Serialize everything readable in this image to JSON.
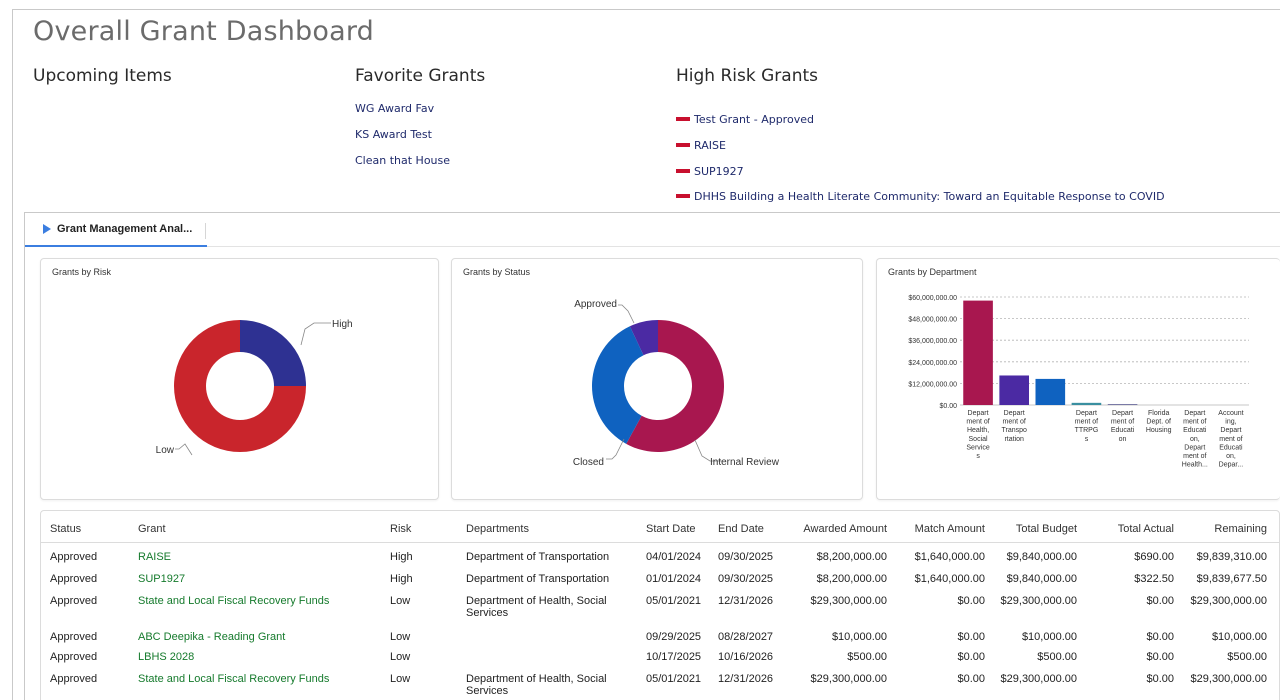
{
  "page": {
    "title": "Overall Grant Dashboard"
  },
  "upcoming": {
    "heading": "Upcoming Items"
  },
  "favorites": {
    "heading": "Favorite Grants",
    "items": [
      "WG Award Fav",
      "KS Award Test",
      "Clean that House"
    ]
  },
  "high_risk": {
    "heading": "High Risk Grants",
    "items": [
      "Test Grant - Approved",
      "RAISE",
      "SUP1927",
      "DHHS Building a Health Literate Community: Toward an Equitable Response to COVID"
    ]
  },
  "analytics": {
    "tab_label": "Grant Management Anal...",
    "tab_icon": "play-triangle-icon",
    "accent_color": "#3b7ee0"
  },
  "chart_data": [
    {
      "type": "pie",
      "donut": true,
      "title": "Grants by Risk",
      "slices": [
        {
          "label": "High",
          "value": 25,
          "color": "#2e3192"
        },
        {
          "label": "Low",
          "value": 75,
          "color": "#c9252c"
        }
      ]
    },
    {
      "type": "pie",
      "donut": true,
      "title": "Grants by Status",
      "slices": [
        {
          "label": "Approved",
          "value": 58,
          "color": "#a8174f"
        },
        {
          "label": "Internal Review",
          "value": 35,
          "color": "#0f62c0"
        },
        {
          "label": "Closed",
          "value": 7,
          "color": "#4b2aa3"
        }
      ]
    },
    {
      "type": "bar",
      "title": "Grants by Department",
      "categories": [
        "Department of Health, Social Services",
        "Department of Transportation",
        "",
        "Department of TTRPGs",
        "Department of Education",
        "Florida Dept. of Housing",
        "Department of Education, Department of Health...",
        "Accounting, Department of Education, Depar..."
      ],
      "category_labels": [
        [
          "Depart",
          "ment of",
          "Health,",
          "Social",
          "Service",
          "s"
        ],
        [
          "Depart",
          "ment of",
          "Transpo",
          "rtation"
        ],
        [],
        [
          "Depart",
          "ment of",
          "TTRPG",
          "s"
        ],
        [
          "Depart",
          "ment of",
          "Educati",
          "on"
        ],
        [
          "Florida",
          "Dept. of",
          "Housing"
        ],
        [
          "Depart",
          "ment of",
          "Educati",
          "on,",
          "Depart",
          "ment of",
          "Health..."
        ],
        [
          "Account",
          "ing,",
          "Depart",
          "ment of",
          "Educati",
          "on,",
          "Depar..."
        ]
      ],
      "values": [
        58000000,
        16400000,
        14500000,
        1200000,
        500000,
        0,
        0,
        0
      ],
      "colors": [
        "#a8174f",
        "#4b2aa3",
        "#0f62c0",
        "#3a8fa0",
        "#6c6c9c",
        "#888888",
        "#888888",
        "#888888"
      ],
      "ylim": [
        0,
        60000000
      ],
      "yticks": [
        "$0.00",
        "$12,000,000.00",
        "$24,000,000.00",
        "$36,000,000.00",
        "$48,000,000.00",
        "$60,000,000.00"
      ],
      "grid": true
    }
  ],
  "table": {
    "columns": [
      "Status",
      "Grant",
      "Risk",
      "Departments",
      "Start Date",
      "End Date",
      "Awarded Amount",
      "Match Amount",
      "Total Budget",
      "Total Actual",
      "Remaining"
    ],
    "rows": [
      [
        "Approved",
        "RAISE",
        "High",
        "Department of Transportation",
        "04/01/2024",
        "09/30/2025",
        "$8,200,000.00",
        "$1,640,000.00",
        "$9,840,000.00",
        "$690.00",
        "$9,839,310.00"
      ],
      [
        "Approved",
        "SUP1927",
        "High",
        "Department of Transportation",
        "01/01/2024",
        "09/30/2025",
        "$8,200,000.00",
        "$1,640,000.00",
        "$9,840,000.00",
        "$322.50",
        "$9,839,677.50"
      ],
      [
        "Approved",
        "State and Local Fiscal Recovery Funds",
        "Low",
        "Department of Health, Social Services",
        "05/01/2021",
        "12/31/2026",
        "$29,300,000.00",
        "$0.00",
        "$29,300,000.00",
        "$0.00",
        "$29,300,000.00"
      ],
      [
        "Approved",
        "ABC Deepika - Reading Grant",
        "Low",
        "",
        "09/29/2025",
        "08/28/2027",
        "$10,000.00",
        "$0.00",
        "$10,000.00",
        "$0.00",
        "$10,000.00"
      ],
      [
        "Approved",
        "LBHS 2028",
        "Low",
        "",
        "10/17/2025",
        "10/16/2026",
        "$500.00",
        "$0.00",
        "$500.00",
        "$0.00",
        "$500.00"
      ],
      [
        "Approved",
        "State and Local Fiscal Recovery Funds",
        "Low",
        "Department of Health, Social Services",
        "05/01/2021",
        "12/31/2026",
        "$29,300,000.00",
        "$0.00",
        "$29,300,000.00",
        "$0.00",
        "$29,300,000.00"
      ]
    ]
  }
}
